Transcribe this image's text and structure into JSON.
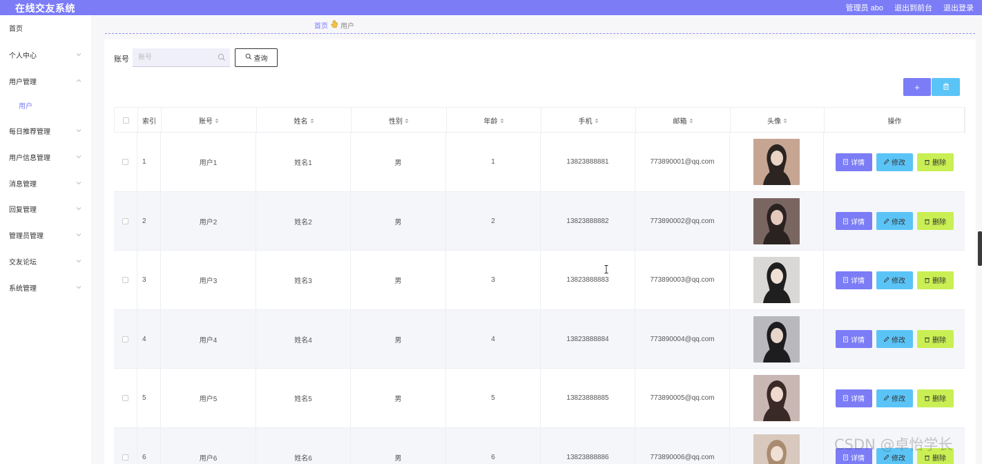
{
  "app": {
    "title": "在线交友系统"
  },
  "header": {
    "admin_label": "管理员 abo",
    "to_front": "退出到前台",
    "logout": "退出登录"
  },
  "sidebar": {
    "items": [
      {
        "label": "首页",
        "has_arrow": false
      },
      {
        "label": "个人中心",
        "has_arrow": true
      },
      {
        "label": "用户管理",
        "has_arrow": true,
        "expanded": true
      },
      {
        "label": "用户",
        "sub": true
      },
      {
        "label": "每日推荐管理",
        "has_arrow": true
      },
      {
        "label": "用户信息管理",
        "has_arrow": true
      },
      {
        "label": "消息管理",
        "has_arrow": true
      },
      {
        "label": "回复管理",
        "has_arrow": true
      },
      {
        "label": "管理员管理",
        "has_arrow": true
      },
      {
        "label": "交友论坛",
        "has_arrow": true
      },
      {
        "label": "系统管理",
        "has_arrow": true
      }
    ]
  },
  "breadcrumb": {
    "home": "首页",
    "current": "用户"
  },
  "search": {
    "label": "账号",
    "placeholder": "账号",
    "value": "",
    "button": "查询"
  },
  "toolbar": {
    "add_symbol": "+",
    "delete_icon": "trash-icon"
  },
  "table": {
    "columns": [
      "索引",
      "账号",
      "姓名",
      "性别",
      "年龄",
      "手机",
      "邮箱",
      "头像",
      "操作"
    ],
    "sortable": [
      false,
      true,
      true,
      true,
      true,
      true,
      true,
      true,
      false
    ],
    "actions": {
      "detail": "详情",
      "edit": "修改",
      "delete": "删除"
    },
    "rows": [
      {
        "index": "1",
        "account": "用户1",
        "name": "姓名1",
        "gender": "男",
        "age": "1",
        "phone": "13823888881",
        "email": "773890001@qq.com"
      },
      {
        "index": "2",
        "account": "用户2",
        "name": "姓名2",
        "gender": "男",
        "age": "2",
        "phone": "13823888882",
        "email": "773890002@qq.com"
      },
      {
        "index": "3",
        "account": "用户3",
        "name": "姓名3",
        "gender": "男",
        "age": "3",
        "phone": "13823888883",
        "email": "773890003@qq.com"
      },
      {
        "index": "4",
        "account": "用户4",
        "name": "姓名4",
        "gender": "男",
        "age": "4",
        "phone": "13823888884",
        "email": "773890004@qq.com"
      },
      {
        "index": "5",
        "account": "用户5",
        "name": "姓名5",
        "gender": "男",
        "age": "5",
        "phone": "13823888885",
        "email": "773890005@qq.com"
      },
      {
        "index": "6",
        "account": "用户6",
        "name": "姓名6",
        "gender": "男",
        "age": "6",
        "phone": "13823888886",
        "email": "773890006@qq.com"
      }
    ]
  },
  "watermark": "CSDN @卓怡学长",
  "colors": {
    "primary": "#7b7cf6",
    "info": "#5bc4f7",
    "lime": "#c9ef54"
  }
}
